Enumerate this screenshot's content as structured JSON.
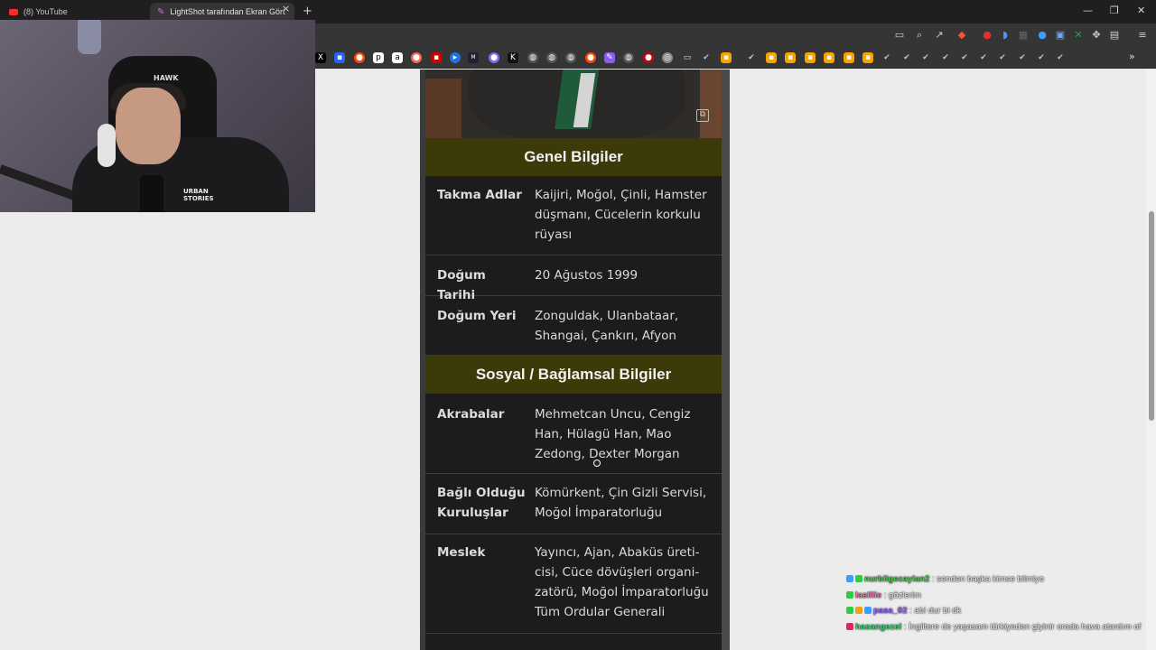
{
  "browser": {
    "tabs": [
      {
        "title": "(8) YouTube",
        "icon": "youtube-icon"
      },
      {
        "title": "LightShot tarafından Ekran Görü",
        "icon": "lightshot-feather-icon"
      }
    ],
    "new_tab_symbol": "+",
    "close_symbol": "×",
    "window_controls": {
      "minimize": "—",
      "maximize": "❐",
      "close": "✕"
    }
  },
  "infobox": {
    "sections": [
      {
        "title": "Genel Bilgiler",
        "rows": [
          {
            "label": "Takma Adlar",
            "value": "Kaijiri, Moğol, Çinli, Hamster düşmanı, Cücelerin korkulu rüyası"
          },
          {
            "label": "Doğum Tarihi",
            "value": "20 Ağustos 1999"
          },
          {
            "label": "Doğum Yeri",
            "value": "Zonguldak, Ulanbataar, Shangai, Çankırı, Afyon"
          }
        ]
      },
      {
        "title": "Sosyal / Bağlamsal Bilgiler",
        "rows": [
          {
            "label": "Akrabalar",
            "value": "Mehmetcan Uncu, Cengiz Han, Hülagü Han, Mao Zedong, Dexter Morgan"
          },
          {
            "label": "Bağlı Olduğu Kuruluşlar",
            "value": "Kömürkent, Çin Gizli Servisi, Moğol İmparatorluğu"
          },
          {
            "label": "Meslek",
            "value": "Yayıncı, Ajan, Abaküs üreti-cisi, Cüce dövüşleri organi-zatörü, Moğol İmparatorluğu Tüm Ordular Generali"
          }
        ]
      }
    ]
  },
  "webcam": {
    "chair_logo": "HAWK",
    "shirt_text": "URBAN STORIES"
  },
  "chat": [
    {
      "user": "nurbilgecaylan2",
      "message": ": senden başka kimse bilmiyo",
      "user_color": "#3fd43f"
    },
    {
      "user": "lasillie",
      "message": ": gözlerim",
      "user_color": "#ff6fb0"
    },
    {
      "user": "pasa_02",
      "message": ": abi dur bi dk",
      "user_color": "#9b6bff"
    },
    {
      "user": "hasangezel",
      "message": ": İngiltere de yaşasam türkiyeden giyinir orada hava atardım of",
      "user_color": "#44d37a"
    }
  ],
  "colors": {
    "section_header_bg": "#3c3a09",
    "infobox_bg": "#1c1c1c",
    "page_bg": "#ececec"
  }
}
